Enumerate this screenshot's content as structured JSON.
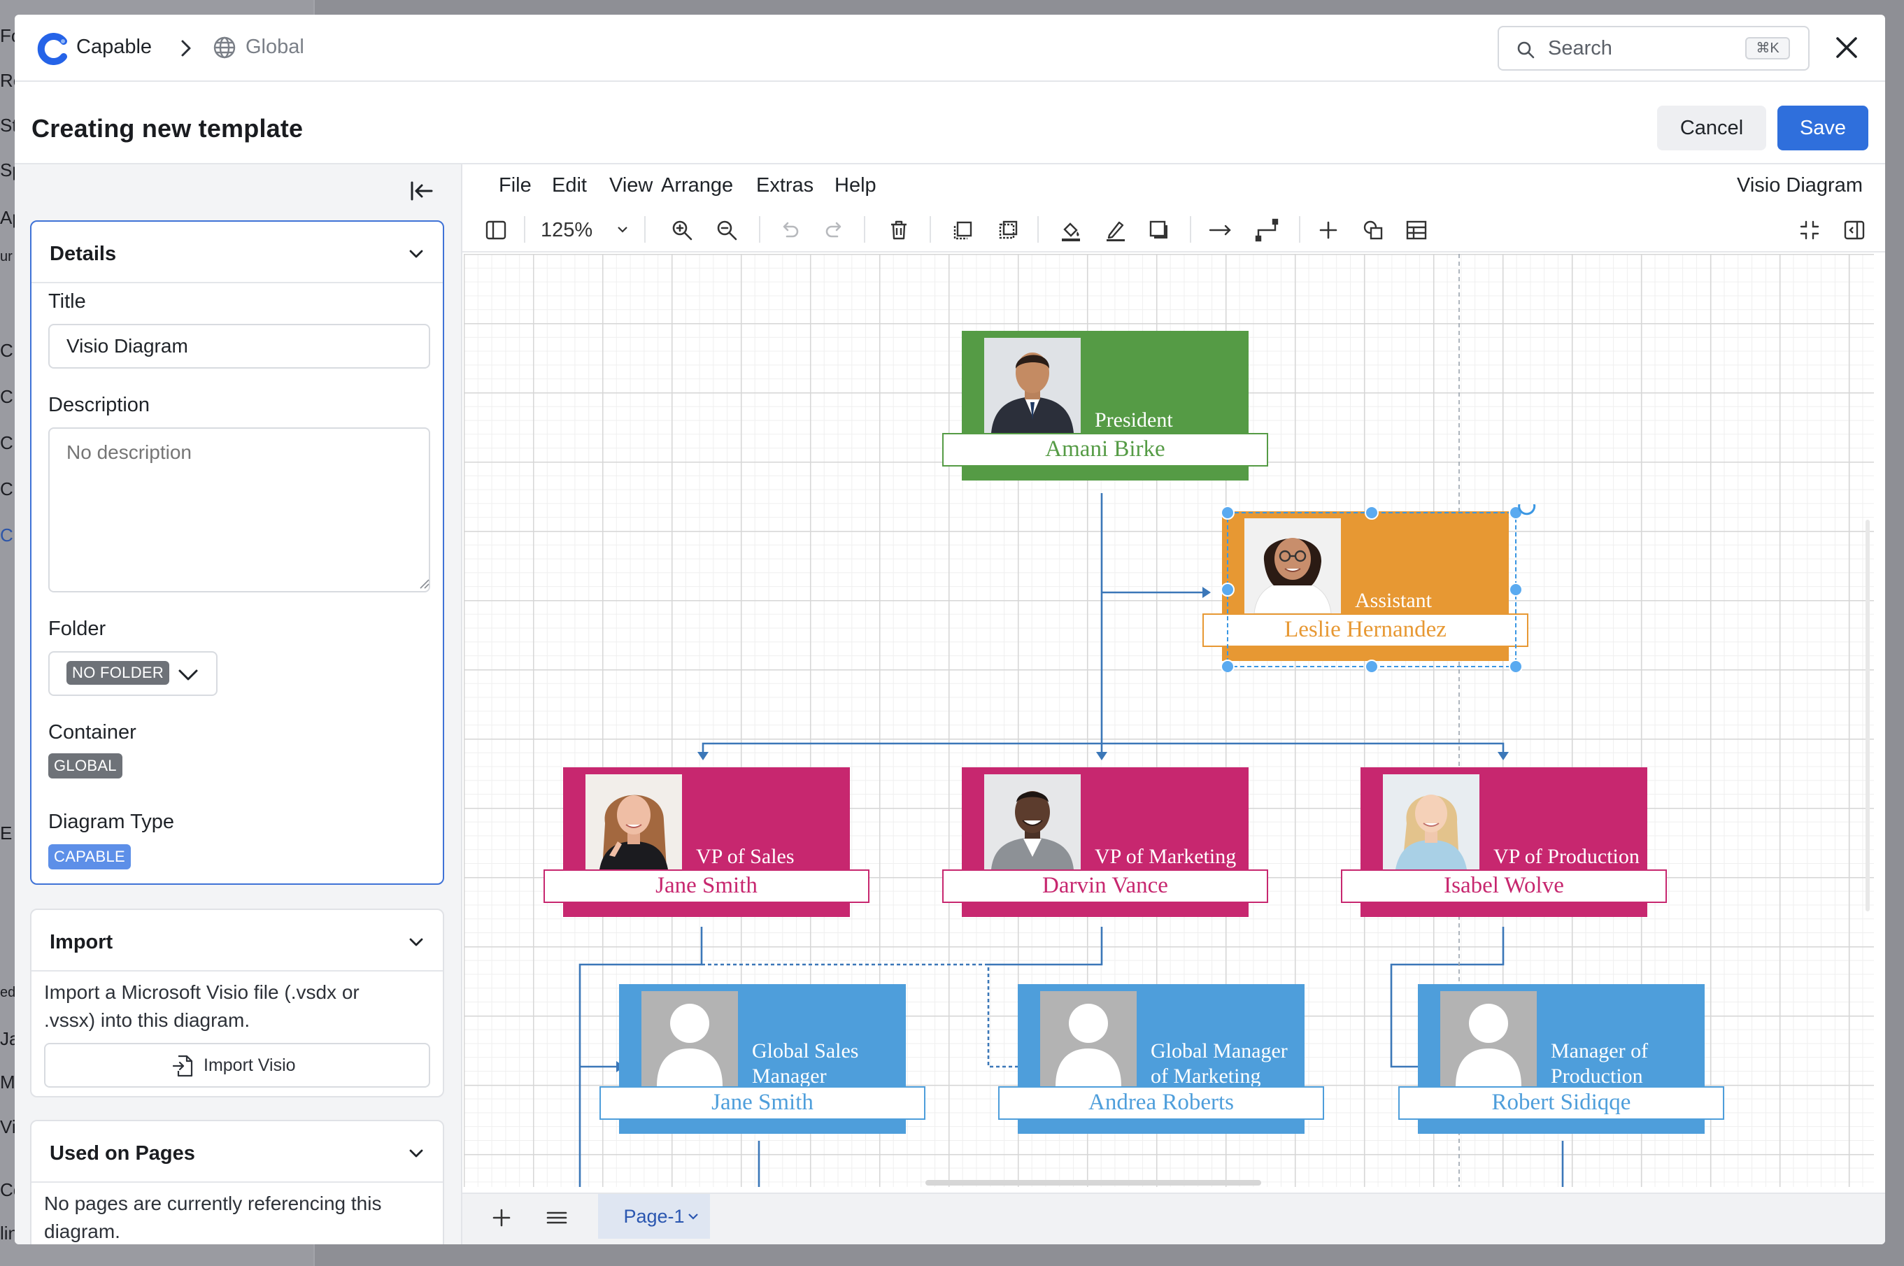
{
  "background_page": {
    "fragments": [
      "Fo",
      "Re",
      "Sta",
      "Sp",
      "Ap",
      "ur",
      "C",
      "C",
      "C",
      "C",
      "C",
      "C",
      "E",
      "ed",
      "Ja",
      "My",
      "Vi",
      "Co",
      "lin"
    ]
  },
  "header": {
    "brand": "Capable",
    "breadcrumb": "Global",
    "search_placeholder": "Search",
    "search_shortcut": "⌘K"
  },
  "titlebar": {
    "title": "Creating new template",
    "cancel_label": "Cancel",
    "save_label": "Save"
  },
  "details": {
    "heading": "Details",
    "title_label": "Title",
    "title_value": "Visio Diagram",
    "description_label": "Description",
    "description_placeholder": "No description",
    "folder_label": "Folder",
    "folder_value": "NO FOLDER",
    "container_label": "Container",
    "container_value": "GLOBAL",
    "diagram_type_label": "Diagram Type",
    "diagram_type_value": "CAPABLE"
  },
  "import": {
    "heading": "Import",
    "text": "Import a Microsoft Visio file (.vsdx or .vssx) into this diagram.",
    "button_label": "Import Visio"
  },
  "used_on_pages": {
    "heading": "Used on Pages",
    "text": "No pages are currently referencing this diagram."
  },
  "editor": {
    "menu": [
      "File",
      "Edit",
      "View",
      "Arrange",
      "Extras",
      "Help"
    ],
    "doc_name": "Visio Diagram",
    "zoom": "125%",
    "page_tab": "Page-1"
  },
  "org_chart": {
    "colors": {
      "president": "#559b45",
      "assistant": "#e79833",
      "vp": "#c7276f",
      "manager": "#4e9edb",
      "connector": "#3b77b8",
      "selection": "#3b97e3"
    },
    "nodes": [
      {
        "role": "President",
        "name": "Amani Birke",
        "color": "#559b45",
        "photo": "man-suit"
      },
      {
        "role": "Assistant",
        "name": "Leslie Hernandez",
        "color": "#e79833",
        "photo": "woman-glasses",
        "selected": true
      },
      {
        "role": "VP of Sales",
        "name": "Jane Smith",
        "color": "#c7276f",
        "photo": "woman-smile"
      },
      {
        "role": "VP of Marketing",
        "name": "Darvin Vance",
        "color": "#c7276f",
        "photo": "man-smile"
      },
      {
        "role": "VP of Production",
        "name": "Isabel Wolve",
        "color": "#c7276f",
        "photo": "woman-blonde"
      },
      {
        "role": "Global Sales Manager",
        "role_lines": [
          "Global Sales",
          "Manager"
        ],
        "name": "Jane Smith",
        "color": "#4e9edb",
        "photo": "placeholder"
      },
      {
        "role": "Global Manager of Marketing",
        "role_lines": [
          "Global Manager",
          "of Marketing"
        ],
        "name": "Andrea Roberts",
        "color": "#4e9edb",
        "photo": "placeholder"
      },
      {
        "role": "Manager of Production",
        "role_lines": [
          "Manager of",
          "Production"
        ],
        "name": "Robert Sidiqqe",
        "color": "#4e9edb",
        "photo": "placeholder"
      }
    ]
  }
}
